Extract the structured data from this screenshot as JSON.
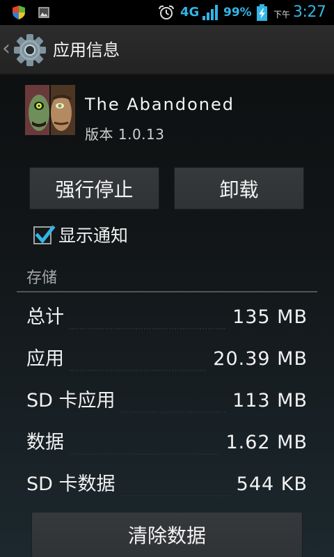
{
  "status_bar": {
    "left_icons": [
      "shield-icon",
      "image-icon"
    ],
    "alarm_icon": "alarm-clock-icon",
    "network": "4G",
    "signal_level": 4,
    "battery_percent": "99%",
    "battery_icon": "battery-charging-icon",
    "period": "下午",
    "time": "3:27"
  },
  "action_bar": {
    "up_icon": "chevron-left-icon",
    "app_icon": "settings-gear-icon",
    "title": "应用信息"
  },
  "app": {
    "icon": "app-icon",
    "name": "The Abandoned",
    "version": "版本 1.0.13"
  },
  "actions": {
    "force_stop": "强行停止",
    "uninstall": "卸载"
  },
  "notifications": {
    "label": "显示通知",
    "checked": true
  },
  "storage": {
    "header": "存储",
    "rows": [
      {
        "label": "总计",
        "value": "135 MB"
      },
      {
        "label": "应用",
        "value": "20.39 MB"
      },
      {
        "label": "SD 卡应用",
        "value": "113 MB"
      },
      {
        "label": "数据",
        "value": "1.62 MB"
      },
      {
        "label": "SD 卡数据",
        "value": "544 KB"
      }
    ]
  },
  "clear_data": "清除数据",
  "colors": {
    "accent": "#33b5e5",
    "text": "#f2f2f2",
    "section_header": "#a8a8a8",
    "button": "#303336"
  }
}
